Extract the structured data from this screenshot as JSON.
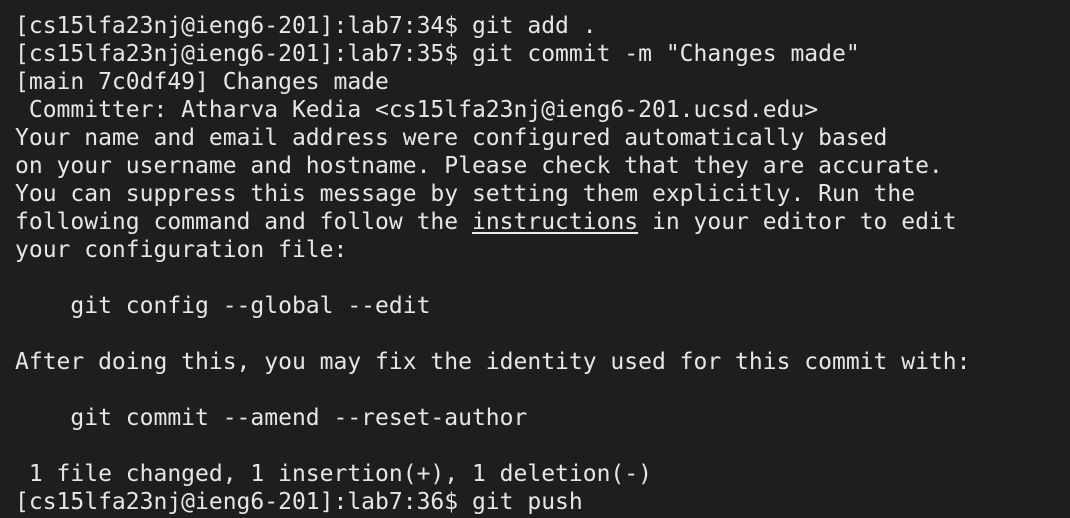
{
  "terminal": {
    "colors": {
      "background": "#1e1e1e",
      "text": "#e6e6e6"
    },
    "lines": [
      "[cs15lfa23nj@ieng6-201]:lab7:34$ git add .",
      "[cs15lfa23nj@ieng6-201]:lab7:35$ git commit -m \"Changes made\"",
      "[main 7c0df49] Changes made",
      " Committer: Atharva Kedia <cs15lfa23nj@ieng6-201.ucsd.edu>",
      "Your name and email address were configured automatically based",
      "on your username and hostname. Please check that they are accurate.",
      "You can suppress this message by setting them explicitly. Run the",
      {
        "before": "following command and follow the ",
        "link": "instructions",
        "after": " in your editor to edit"
      },
      "your configuration file:",
      "",
      "    git config --global --edit",
      "",
      "After doing this, you may fix the identity used for this commit with:",
      "",
      "    git commit --amend --reset-author",
      "",
      " 1 file changed, 1 insertion(+), 1 deletion(-)",
      "[cs15lfa23nj@ieng6-201]:lab7:36$ git push"
    ]
  }
}
